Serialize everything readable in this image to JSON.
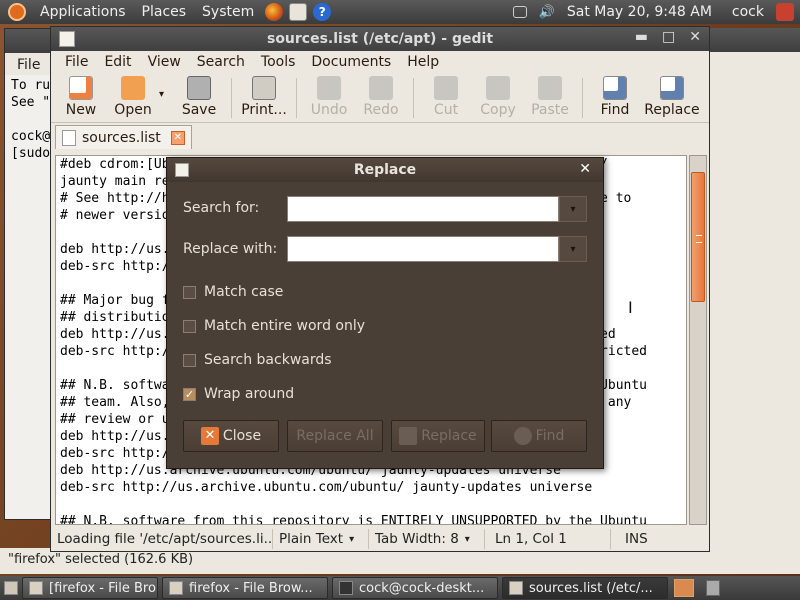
{
  "top_panel": {
    "menus": [
      "Applications",
      "Places",
      "System"
    ],
    "datetime": "Sat May 20,  9:48 AM",
    "user": "cock"
  },
  "terminal": {
    "menu": "File",
    "lines": [
      "To ru",
      "See \"",
      "",
      "cock@",
      "[sudo"
    ]
  },
  "file_status": "\"firefox\" selected (162.6 KB)",
  "gedit": {
    "title": "sources.list (/etc/apt) - gedit",
    "menu": [
      "File",
      "Edit",
      "View",
      "Search",
      "Tools",
      "Documents",
      "Help"
    ],
    "toolbar": {
      "new": "New",
      "open": "Open",
      "save": "Save",
      "print": "Print...",
      "undo": "Undo",
      "redo": "Redo",
      "cut": "Cut",
      "copy": "Copy",
      "paste": "Paste",
      "find": "Find",
      "replace": "Replace"
    },
    "tab_label": "sources.list",
    "editor_text": "#deb cdrom:[Ubuntu 9.04 _Jaunty Jackalope_ - Release i386 (20090421)]/\njaunty main restricted\n# See http://help.ubuntu.com/community/UpgradeNotes for how to upgrade to\n# newer versions of the distribution.\n\ndeb http://us.archive.ubuntu.com/ubuntu/ jaunty main restricted\ndeb-src http://us.archive.ubuntu.com/ubuntu/ jaunty main restricted\n\n## Major bug fix updates produced after the final release of the\n## distribution.\ndeb http://us.archive.ubuntu.com/ubuntu/ jaunty-updates main restricted\ndeb-src http://us.archive.ubuntu.com/ubuntu/ jaunty-updates main restricted\n\n## N.B. software from this repository is ENTIRELY UNSUPPORTED by the Ubuntu\n## team. Also, please note that software in universe WILL NOT receive any\n## review or updates from the Ubuntu security team.\ndeb http://us.archive.ubuntu.com/ubuntu/ jaunty universe\ndeb-src http://us.archive.ubuntu.com/ubuntu/ jaunty universe\ndeb http://us.archive.ubuntu.com/ubuntu/ jaunty-updates universe\ndeb-src http://us.archive.ubuntu.com/ubuntu/ jaunty-updates universe\n\n## N.B. software from this repository is ENTIRELY UNSUPPORTED by the Ubuntu",
    "statusbar": {
      "loading": "Loading file '/etc/apt/sources.li...",
      "language": "Plain Text",
      "tab_width": "Tab Width:  8",
      "position": "Ln 1, Col 1",
      "mode": "INS"
    }
  },
  "replace_dialog": {
    "title": "Replace",
    "search_label": "Search for:",
    "replace_label": "Replace with:",
    "search_value": "",
    "replace_value": "",
    "options": [
      {
        "label": "Match case",
        "checked": false
      },
      {
        "label": "Match entire word only",
        "checked": false
      },
      {
        "label": "Search backwards",
        "checked": false
      },
      {
        "label": "Wrap around",
        "checked": true
      }
    ],
    "buttons": {
      "close": "Close",
      "replace_all": "Replace All",
      "replace": "Replace",
      "find": "Find"
    }
  },
  "taskbar": [
    {
      "label": "[firefox - File Bro...",
      "active": false
    },
    {
      "label": "firefox - File Brow...",
      "active": false
    },
    {
      "label": "cock@cock-deskt...",
      "active": false
    },
    {
      "label": "sources.list (/etc/...",
      "active": true
    }
  ],
  "colors": {
    "accent": "#e67838",
    "panel": "#3b3b3b",
    "dialog_bg": "#4a3f37"
  }
}
